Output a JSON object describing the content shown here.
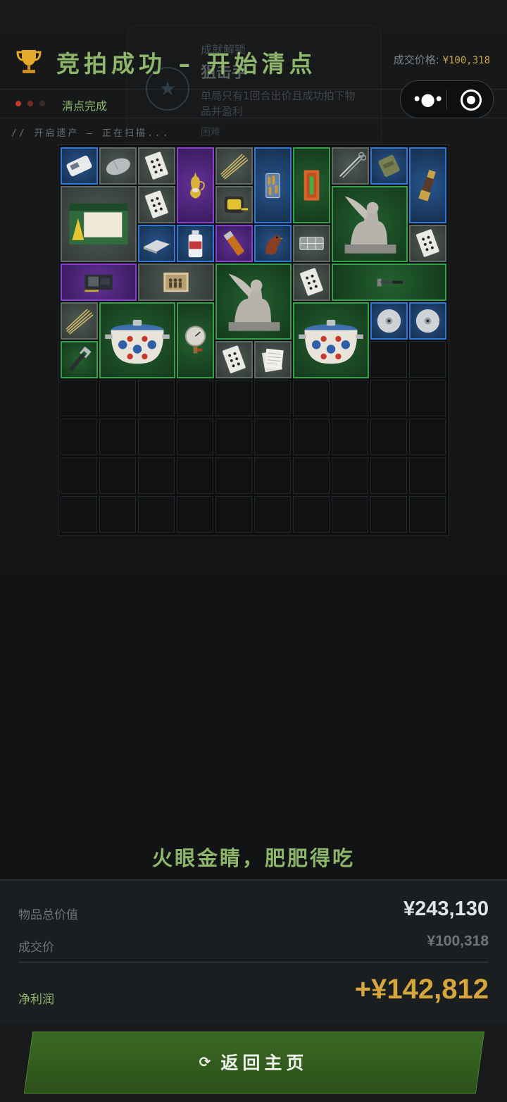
{
  "header": {
    "title": "竞拍成功 – 开始清点",
    "deal_price_label": "成交价格:",
    "deal_price_value": "¥100,318",
    "status": "清点完成",
    "scan_text": "// 开启遗产 – 正在扫描...",
    "dot_colors": [
      "#c0392b",
      "#7a2a24",
      "#3a2a28"
    ]
  },
  "toast": {
    "title": "成就解锁",
    "name": "狙击手",
    "desc": "单局只有1回合出价且成功拍下物品并盈利",
    "difficulty": "困难"
  },
  "capsule": {
    "more_icon": "more-dots-icon",
    "close_icon": "target-close-icon"
  },
  "inventory": {
    "items": [
      {
        "name": "handheld-device",
        "rarity": "blue",
        "icon": "handheld-device"
      },
      {
        "name": "computer-mouse",
        "rarity": "grey",
        "icon": "mouse"
      },
      {
        "name": "playing-card",
        "rarity": "grey",
        "icon": "card"
      },
      {
        "name": "golden-ewer",
        "rarity": "purple",
        "icon": "ewer"
      },
      {
        "name": "gold-wire",
        "rarity": "grey",
        "icon": "wire"
      },
      {
        "name": "ammo-jar",
        "rarity": "blue",
        "icon": "ammo"
      },
      {
        "name": "orange-case",
        "rarity": "green",
        "icon": "case"
      },
      {
        "name": "scissors",
        "rarity": "grey",
        "icon": "scissors"
      },
      {
        "name": "ration-pack",
        "rarity": "blue",
        "icon": "pack"
      },
      {
        "name": "telescope",
        "rarity": "blue",
        "icon": "telescope"
      },
      {
        "name": "emergency-candles",
        "rarity": "grey",
        "icon": "candles"
      },
      {
        "name": "playing-card",
        "rarity": "grey",
        "icon": "card"
      },
      {
        "name": "tape-measure",
        "rarity": "grey",
        "icon": "tape"
      },
      {
        "name": "sphinx-statue",
        "rarity": "green",
        "icon": "sphinx"
      },
      {
        "name": "metal-plate",
        "rarity": "blue",
        "icon": "plate"
      },
      {
        "name": "medicine-bottle",
        "rarity": "blue",
        "icon": "bottle"
      },
      {
        "name": "lighter",
        "rarity": "purple",
        "icon": "lighter"
      },
      {
        "name": "wooden-bird",
        "rarity": "blue",
        "icon": "bird"
      },
      {
        "name": "plastic-tray",
        "rarity": "grey",
        "icon": "tray"
      },
      {
        "name": "playing-card",
        "rarity": "grey",
        "icon": "card"
      },
      {
        "name": "graphics-card",
        "rarity": "purple",
        "icon": "gpu"
      },
      {
        "name": "old-photo",
        "rarity": "grey",
        "icon": "photo"
      },
      {
        "name": "sphinx-statue",
        "rarity": "green",
        "icon": "sphinx"
      },
      {
        "name": "playing-card",
        "rarity": "grey",
        "icon": "card"
      },
      {
        "name": "sledgehammer",
        "rarity": "green",
        "icon": "hammer"
      },
      {
        "name": "gold-wire",
        "rarity": "grey",
        "icon": "wire"
      },
      {
        "name": "enamel-pot",
        "rarity": "green",
        "icon": "pot"
      },
      {
        "name": "pressure-gauge",
        "rarity": "green",
        "icon": "gauge"
      },
      {
        "name": "enamel-pot",
        "rarity": "green",
        "icon": "pot"
      },
      {
        "name": "disc",
        "rarity": "blue",
        "icon": "disc"
      },
      {
        "name": "disc",
        "rarity": "blue",
        "icon": "disc"
      },
      {
        "name": "wrench",
        "rarity": "green",
        "icon": "wrench"
      },
      {
        "name": "playing-card",
        "rarity": "grey",
        "icon": "card"
      },
      {
        "name": "paper-stack",
        "rarity": "grey",
        "icon": "papers"
      }
    ]
  },
  "slogan": "火眼金睛，肥肥得吃",
  "summary": {
    "total_label": "物品总价值",
    "total_value": "¥243,130",
    "deal_label": "成交价",
    "deal_value": "¥100,318",
    "profit_label": "净利润",
    "profit_value": "+¥142,812",
    "colors": {
      "profit": "#d4a63c",
      "label_green": "#8db66a"
    }
  },
  "return_button": {
    "label": "返回主页",
    "icon": "refresh-icon"
  }
}
